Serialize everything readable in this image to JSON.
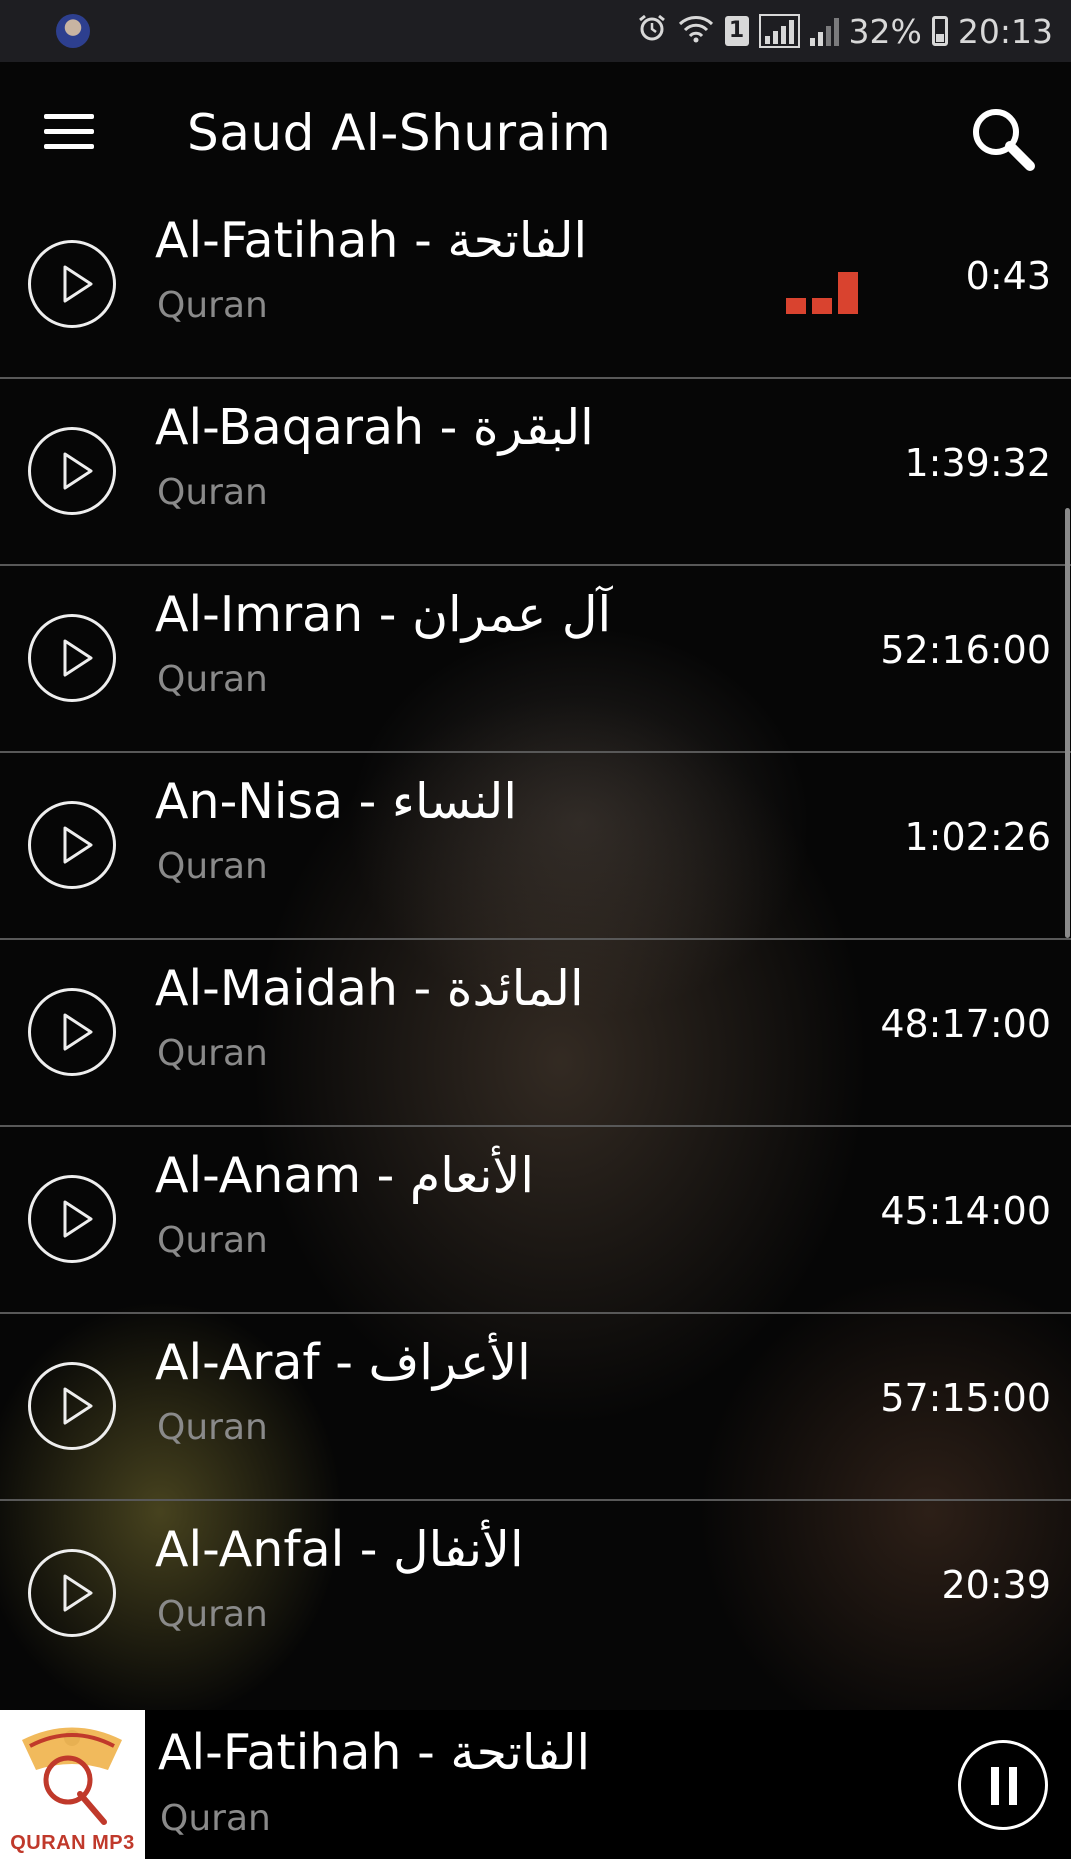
{
  "status_bar": {
    "battery": "32%",
    "time": "20:13",
    "sim_slot": "1",
    "icons": [
      "avatar",
      "alarm-icon",
      "wifi-icon",
      "sim-1-icon",
      "signal-icon",
      "signal-icon",
      "battery-icon"
    ]
  },
  "app_bar": {
    "title": "Saud Al-Shuraim",
    "menu_icon": "hamburger-menu-icon",
    "search_icon": "search-icon"
  },
  "tracks": [
    {
      "title": "Al-Fatihah - الفاتحة",
      "subtitle": "Quran",
      "duration": "0:43",
      "playing": true
    },
    {
      "title": "Al-Baqarah - البقرة",
      "subtitle": "Quran",
      "duration": "1:39:32"
    },
    {
      "title": "Al-Imran - آل عمران",
      "subtitle": "Quran",
      "duration": "52:16:00"
    },
    {
      "title": "An-Nisa - النساء",
      "subtitle": "Quran",
      "duration": "1:02:26"
    },
    {
      "title": "Al-Maidah - المائدة",
      "subtitle": "Quran",
      "duration": "48:17:00"
    },
    {
      "title": "Al-Anam - الأنعام",
      "subtitle": "Quran",
      "duration": "45:14:00"
    },
    {
      "title": "Al-Araf - الأعراف",
      "subtitle": "Quran",
      "duration": "57:15:00"
    },
    {
      "title": "Al-Anfal - الأنفال",
      "subtitle": "Quran",
      "duration": "20:39"
    }
  ],
  "now_playing": {
    "title": "Al-Fatihah - الفاتحة",
    "subtitle": "Quran",
    "logo_text": "QURAN MP3",
    "control_icon": "pause-icon"
  },
  "colors": {
    "background": "#000000",
    "status_bar": "#1e1e22",
    "accent_equalizer": "#d9432f",
    "subtitle": "#8a8a8a",
    "divider": "#585858"
  }
}
